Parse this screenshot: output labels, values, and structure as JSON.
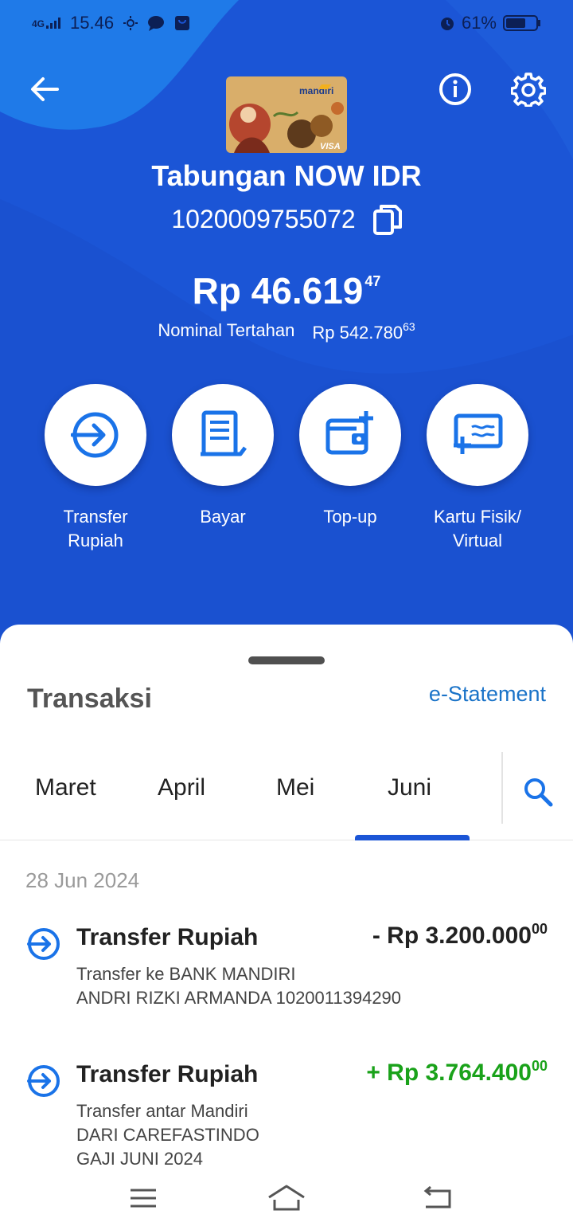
{
  "status_bar": {
    "network": "4G",
    "time": "15.46",
    "battery": "61%"
  },
  "account": {
    "name": "Tabungan NOW IDR",
    "number": "1020009755072",
    "balance_main": "Rp 46.619",
    "balance_cents": "47",
    "held_label": "Nominal Tertahan",
    "held_main": "Rp 542.780",
    "held_cents": "63"
  },
  "card": {
    "brand": "mandiri",
    "network": "VISA"
  },
  "actions": [
    {
      "label": "Transfer\nRupiah",
      "icon": "transfer-icon"
    },
    {
      "label": "Bayar",
      "icon": "bill-icon"
    },
    {
      "label": "Top-up",
      "icon": "wallet-add-icon"
    },
    {
      "label": "Kartu Fisik/\nVirtual",
      "icon": "card-add-icon"
    }
  ],
  "transactions_section": {
    "title": "Transaksi",
    "estatement": "e-Statement",
    "tabs": [
      "Maret",
      "April",
      "Mei",
      "Juni"
    ],
    "active_tab": "Juni",
    "date": "28 Jun 2024",
    "items": [
      {
        "name": "Transfer Rupiah",
        "sign_amount": "- Rp 3.200.000",
        "cents": "00",
        "type": "debit",
        "desc1": "Transfer ke BANK MANDIRI",
        "desc2": "ANDRI RIZKI ARMANDA 1020011394290",
        "desc3": ""
      },
      {
        "name": "Transfer Rupiah",
        "sign_amount": "+ Rp 3.764.400",
        "cents": "00",
        "type": "credit",
        "desc1": "Transfer antar Mandiri",
        "desc2": "DARI CAREFASTINDO",
        "desc3": "GAJI JUNI 2024"
      }
    ]
  },
  "colors": {
    "header_blue": "#1b55d6",
    "accent_blue": "#1a73c8",
    "credit_green": "#1aa21a",
    "debit_text": "#222222"
  }
}
